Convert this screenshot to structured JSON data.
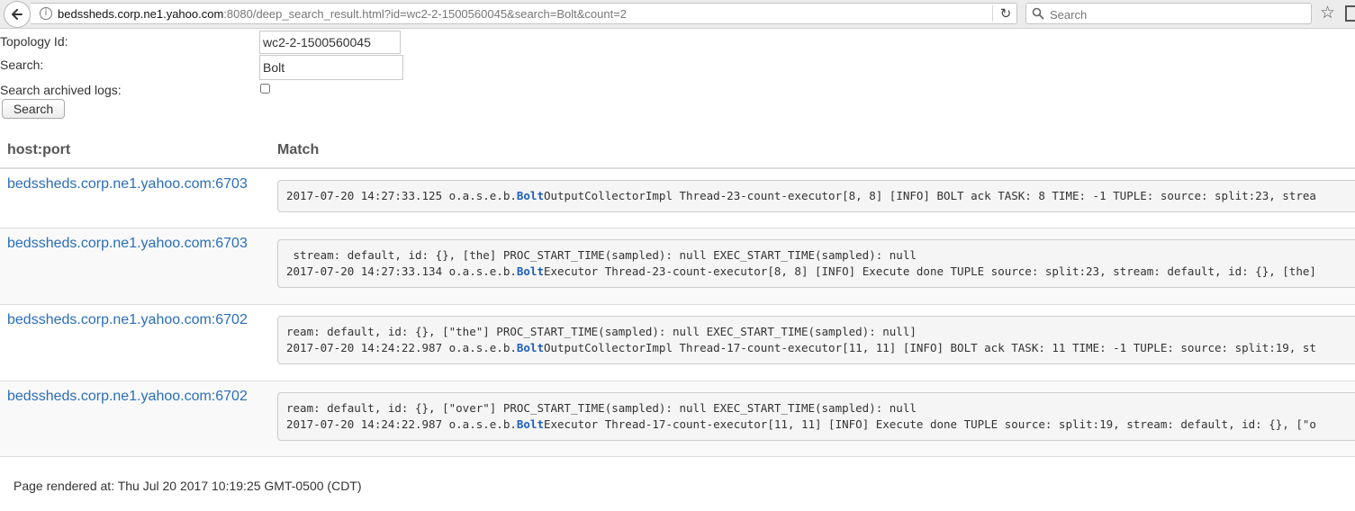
{
  "browser": {
    "url_host": "bedssheds.corp.ne1.yahoo.com",
    "url_rest": ":8080/deep_search_result.html?id=wc2-2-1500560045&search=Bolt&count=2",
    "search_placeholder": "Search",
    "icons": [
      "back-arrow-icon",
      "info-icon",
      "reload-icon",
      "search-icon",
      "bookmark-star-icon"
    ]
  },
  "form": {
    "topology_label": "Topology Id:",
    "topology_value": "wc2-2-1500560045",
    "search_label": "Search:",
    "search_value": "Bolt",
    "archived_label": "Search archived logs:",
    "archived_checked": false,
    "search_button": "Search"
  },
  "table": {
    "headers": [
      "host:port",
      "Match"
    ],
    "rows": [
      {
        "host": "bedssheds.corp.ne1.yahoo.com:6703",
        "lines": [
          {
            "pre": "2017-07-20 14:27:33.125 o.a.s.e.b.",
            "hl": "Bolt",
            "post": "OutputCollectorImpl Thread-23-count-executor[8, 8] [INFO] BOLT ack TASK: 8 TIME: -1 TUPLE: source: split:23, strea"
          }
        ]
      },
      {
        "host": "bedssheds.corp.ne1.yahoo.com:6703",
        "lines": [
          {
            "pre": " stream: default, id: {}, [the] PROC_START_TIME(sampled): null EXEC_START_TIME(sampled): null",
            "hl": "",
            "post": ""
          },
          {
            "pre": "2017-07-20 14:27:33.134 o.a.s.e.b.",
            "hl": "Bolt",
            "post": "Executor Thread-23-count-executor[8, 8] [INFO] Execute done TUPLE source: split:23, stream: default, id: {}, [the]"
          }
        ]
      },
      {
        "host": "bedssheds.corp.ne1.yahoo.com:6702",
        "lines": [
          {
            "pre": "ream: default, id: {}, [\"the\"] PROC_START_TIME(sampled): null EXEC_START_TIME(sampled): null]",
            "hl": "",
            "post": ""
          },
          {
            "pre": "2017-07-20 14:24:22.987 o.a.s.e.b.",
            "hl": "Bolt",
            "post": "OutputCollectorImpl Thread-17-count-executor[11, 11] [INFO] BOLT ack TASK: 11 TIME: -1 TUPLE: source: split:19, st"
          }
        ]
      },
      {
        "host": "bedssheds.corp.ne1.yahoo.com:6702",
        "lines": [
          {
            "pre": "ream: default, id: {}, [\"over\"] PROC_START_TIME(sampled): null EXEC_START_TIME(sampled): null",
            "hl": "",
            "post": ""
          },
          {
            "pre": "2017-07-20 14:24:22.987 o.a.s.e.b.",
            "hl": "Bolt",
            "post": "Executor Thread-17-count-executor[11, 11] [INFO] Execute done TUPLE source: split:19, stream: default, id: {}, [\"o"
          }
        ]
      }
    ]
  },
  "footer": {
    "rendered": "Page rendered at: Thu Jul 20 2017 10:19:25 GMT-0500 (CDT)"
  },
  "colors": {
    "link": "#2a6ebb",
    "highlight": "#1f5fbf",
    "header_text": "#555555"
  }
}
